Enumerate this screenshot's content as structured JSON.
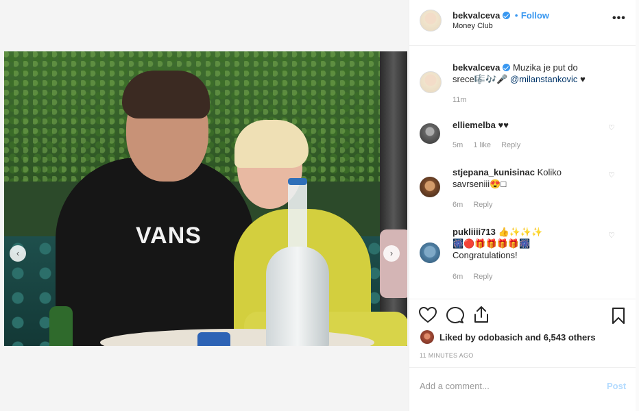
{
  "post": {
    "username": "bekvalceva",
    "location": "Money Club",
    "follow_separator": "•",
    "follow_label": "Follow",
    "more_label": "•••"
  },
  "photo": {
    "shirt_text": "VANS",
    "prev_label": "‹",
    "next_label": "›"
  },
  "caption": {
    "username": "bekvalceva",
    "text": "Muzika je put do srece🎼🎶🎤",
    "mention": "@milanstankovic",
    "suffix": "♥",
    "time": "11m"
  },
  "comments": [
    {
      "username": "elliemelba",
      "text": "♥♥",
      "time": "5m",
      "likes": "1 like",
      "reply": "Reply"
    },
    {
      "username": "stjepana_kunisinac",
      "text": "Koliko savrseniii😍□",
      "time": "6m",
      "reply": "Reply"
    },
    {
      "username": "pukliiii713",
      "text_line1": "👍✨✨✨",
      "text_line2": "🎆🔴🎁🎁🎁🎁🎆",
      "text_line3": "Congratulations!",
      "time": "6m",
      "reply": "Reply"
    }
  ],
  "likes_text": "Liked by odobasich and 6,543 others",
  "time_ago": "11 MINUTES AGO",
  "add_comment_placeholder": "Add a comment...",
  "post_button": "Post",
  "colors": {
    "accent": "#3897f0",
    "post_disabled": "#b3dbff"
  }
}
